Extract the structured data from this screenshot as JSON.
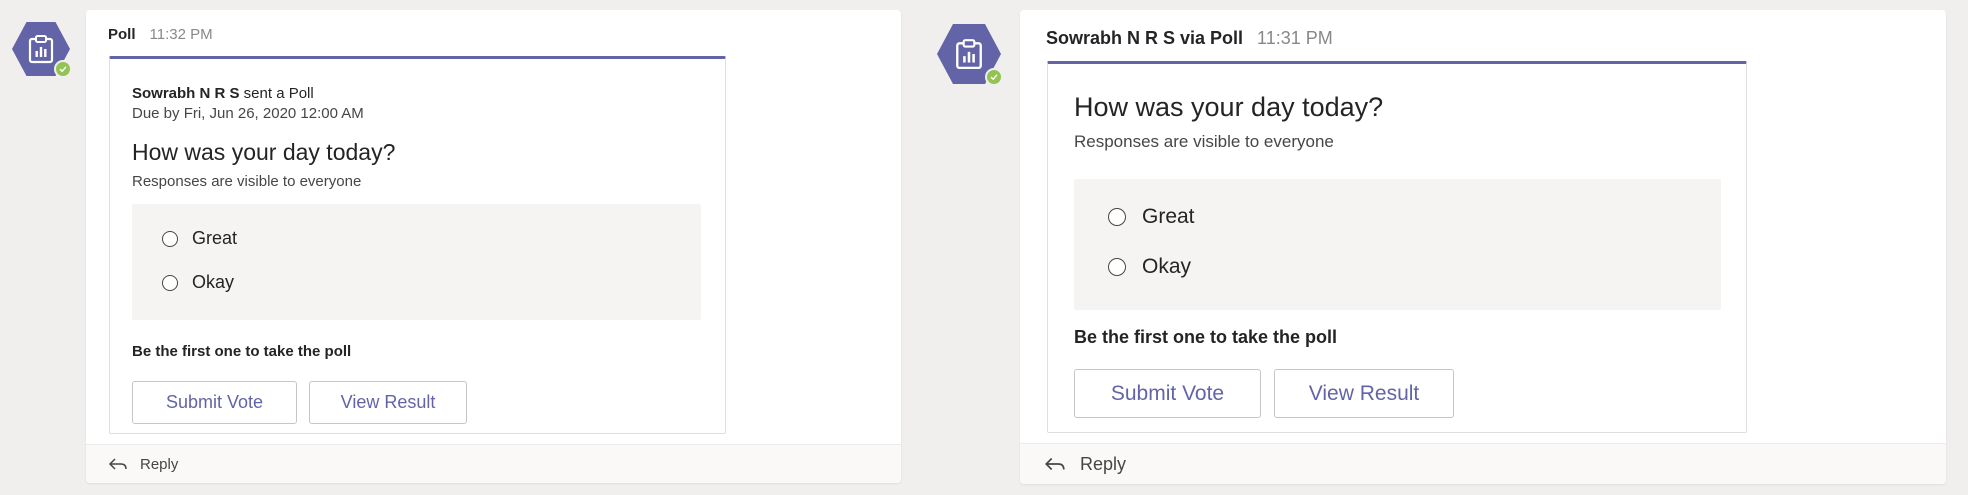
{
  "left_message": {
    "sender": "Poll",
    "time": "11:32 PM",
    "card": {
      "intro_sender": "Sowrabh N R S",
      "intro_suffix": " sent a Poll",
      "due": "Due by Fri, Jun 26, 2020 12:00 AM",
      "question": "How was your day today?",
      "visibility": "Responses are visible to everyone",
      "options": [
        "Great",
        "Okay"
      ],
      "cta": "Be the first one to take the poll",
      "submit_label": "Submit Vote",
      "view_label": "View Result"
    },
    "reply_label": "Reply"
  },
  "right_message": {
    "sender": "Sowrabh N R S via Poll",
    "time": "11:31 PM",
    "card": {
      "question": "How was your day today?",
      "visibility": "Responses are visible to everyone",
      "options": [
        "Great",
        "Okay"
      ],
      "cta": "Be the first one to take the poll",
      "submit_label": "Submit Vote",
      "view_label": "View Result"
    },
    "reply_label": "Reply"
  },
  "colors": {
    "accent": "#6264a7",
    "presence": "#92c353",
    "background": "#f0efee"
  },
  "icons": {
    "avatar": "poll-clipboard-icon",
    "status": "available-check-icon",
    "reply": "reply-arrow-icon"
  }
}
